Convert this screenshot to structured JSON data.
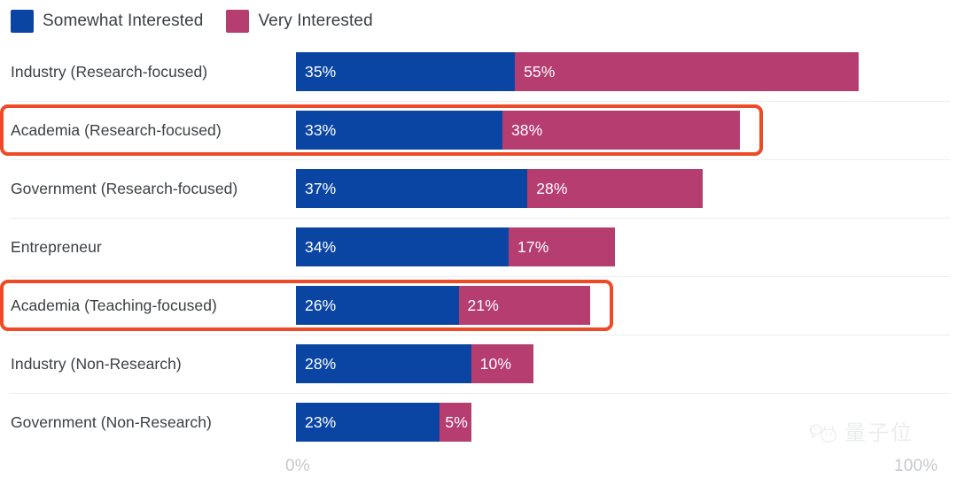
{
  "legend": {
    "items": [
      {
        "label": "Somewhat Interested",
        "color": "#0b45a4",
        "icon": "square-swatch-icon"
      },
      {
        "label": "Very Interested",
        "color": "#b53d70",
        "icon": "square-swatch-icon"
      }
    ]
  },
  "axis": {
    "min_label": "0%",
    "max_label": "100%"
  },
  "watermark": {
    "text": "量子位",
    "icon": "qbitai-cat-logo-icon"
  },
  "rows": [
    {
      "label": "Industry (Research-focused)",
      "somewhat": "35%",
      "very": "55%",
      "highlighted": false
    },
    {
      "label": "Academia (Research-focused)",
      "somewhat": "33%",
      "very": "38%",
      "highlighted": true
    },
    {
      "label": "Government (Research-focused)",
      "somewhat": "37%",
      "very": "28%",
      "highlighted": false
    },
    {
      "label": "Entrepreneur",
      "somewhat": "34%",
      "very": "17%",
      "highlighted": false
    },
    {
      "label": "Academia (Teaching-focused)",
      "somewhat": "26%",
      "very": "21%",
      "highlighted": true
    },
    {
      "label": "Industry (Non-Research)",
      "somewhat": "28%",
      "very": "10%",
      "highlighted": false
    },
    {
      "label": "Government (Non-Research)",
      "somewhat": "23%",
      "very": "5%",
      "highlighted": false
    }
  ],
  "chart_data": {
    "type": "bar",
    "orientation": "horizontal",
    "stacked": true,
    "title": "",
    "xlabel": "",
    "ylabel": "",
    "xlim": [
      0,
      100
    ],
    "x_tick_labels": [
      "0%",
      "100%"
    ],
    "grid": false,
    "legend_position": "top-left",
    "categories": [
      "Industry (Research-focused)",
      "Academia (Research-focused)",
      "Government (Research-focused)",
      "Entrepreneur",
      "Academia (Teaching-focused)",
      "Industry (Non-Research)",
      "Government (Non-Research)"
    ],
    "series": [
      {
        "name": "Somewhat Interested",
        "color": "#0b45a4",
        "values": [
          35,
          33,
          37,
          34,
          26,
          28,
          23
        ]
      },
      {
        "name": "Very Interested",
        "color": "#b53d70",
        "values": [
          55,
          38,
          28,
          17,
          21,
          10,
          5
        ]
      }
    ],
    "totals": [
      90,
      71,
      65,
      51,
      47,
      38,
      28
    ],
    "annotations": [
      {
        "type": "highlight-rectangle",
        "target": "Academia (Research-focused)",
        "color": "#ef4a27"
      },
      {
        "type": "highlight-rectangle",
        "target": "Academia (Teaching-focused)",
        "color": "#ef4a27"
      }
    ]
  }
}
